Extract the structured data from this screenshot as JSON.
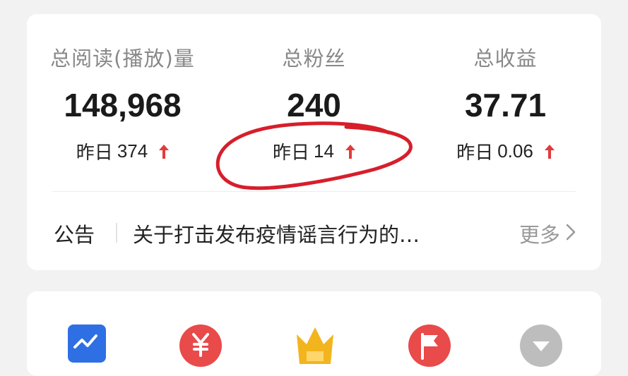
{
  "stats": [
    {
      "label": "总阅读(播放)量",
      "value": "148,968",
      "delta_prefix": "昨日",
      "delta_value": "374"
    },
    {
      "label": "总粉丝",
      "value": "240",
      "delta_prefix": "昨日",
      "delta_value": "14"
    },
    {
      "label": "总收益",
      "value": "37.71",
      "delta_prefix": "昨日",
      "delta_value": "0.06"
    }
  ],
  "notice": {
    "tag": "公告",
    "text": "关于打击发布疫情谣言行为的…",
    "more": "更多"
  },
  "colors": {
    "up_arrow": "#e23b3b",
    "annotation": "#d61f2b",
    "tool_blue": "#2f6fe4",
    "tool_red": "#e94a4a",
    "tool_gold": "#f3b51e",
    "tool_red_flag": "#e94a4a",
    "tool_gray": "#bdbdbd"
  },
  "tools": [
    {
      "icon": "trend-chart-icon"
    },
    {
      "icon": "yuan-coin-icon"
    },
    {
      "icon": "crown-icon"
    },
    {
      "icon": "flag-icon"
    },
    {
      "icon": "chevron-down-circle-icon"
    }
  ]
}
